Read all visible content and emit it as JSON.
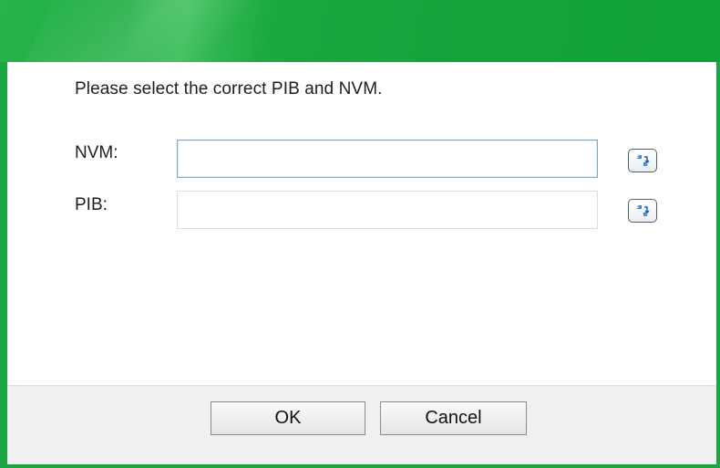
{
  "dialog": {
    "instruction": "Please select the correct PIB and NVM.",
    "fields": {
      "nvm": {
        "label": "NVM:",
        "value": "",
        "placeholder": ""
      },
      "pib": {
        "label": "PIB:",
        "value": "",
        "placeholder": ""
      }
    },
    "browse_icon": "folder-refresh-icon",
    "buttons": {
      "ok": "OK",
      "cancel": "Cancel"
    }
  },
  "colors": {
    "title_bar": "#1aa83f",
    "footer": "#f0f0f0",
    "icon_accent": "#2a7fd0"
  }
}
